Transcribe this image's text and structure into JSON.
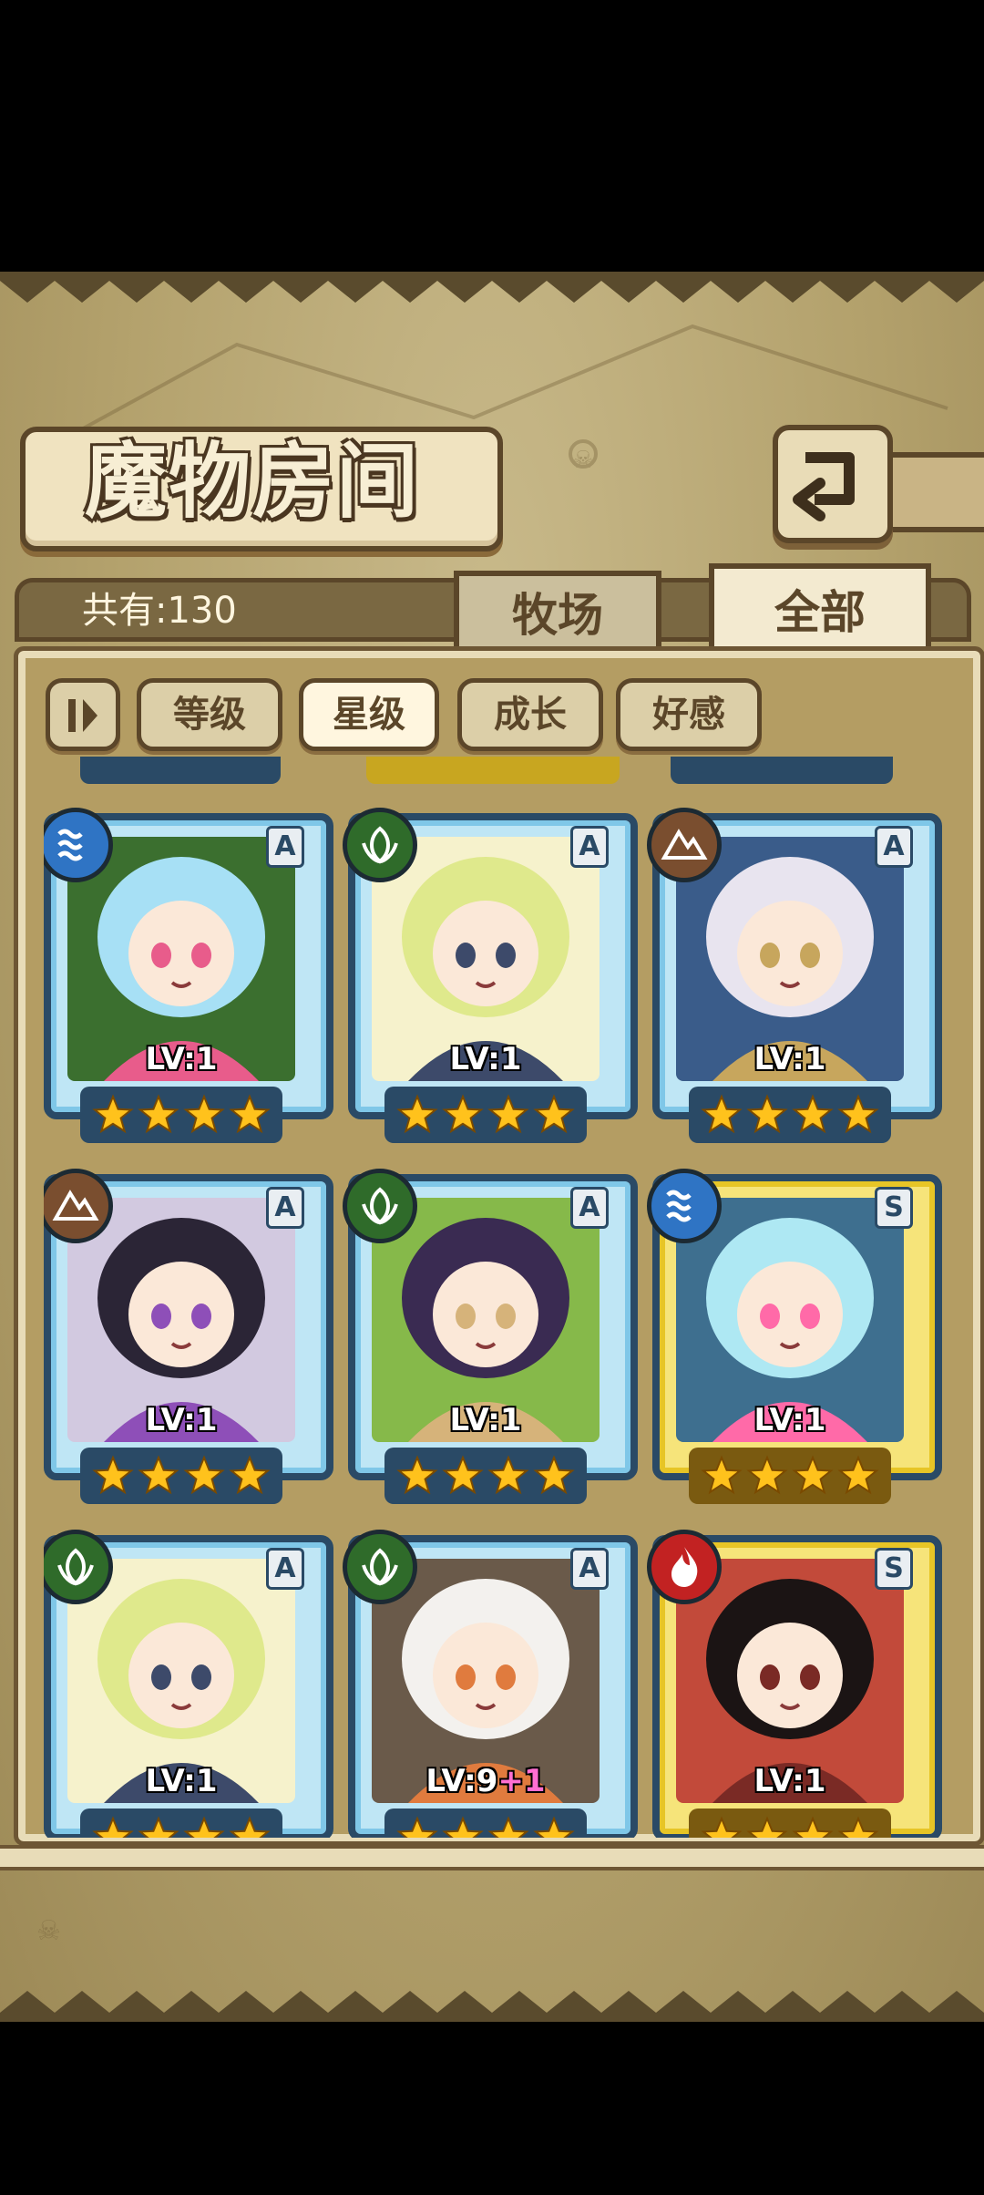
{
  "screen": {
    "title": "魔物房间",
    "count_label": "共有:130",
    "tabs": [
      {
        "label": "牧场",
        "active": false
      },
      {
        "label": "全部",
        "active": true
      }
    ],
    "sort": {
      "toggle_icon": "sort-toggle-icon",
      "options": [
        {
          "label": "等级",
          "selected": false
        },
        {
          "label": "星级",
          "selected": true
        },
        {
          "label": "成长",
          "selected": false
        },
        {
          "label": "好感",
          "selected": false
        }
      ]
    }
  },
  "cards": [
    {
      "element": "water",
      "rank": "A",
      "level": "LV:1",
      "plus": "",
      "stars": 4,
      "palette": [
        "#a7e0f5",
        "#e85c8b",
        "#3b6f2f"
      ]
    },
    {
      "element": "nature",
      "rank": "A",
      "level": "LV:1",
      "plus": "",
      "stars": 4,
      "palette": [
        "#dfe98c",
        "#3d4a6a",
        "#f6f2cc"
      ]
    },
    {
      "element": "earth",
      "rank": "A",
      "level": "LV:1",
      "plus": "",
      "stars": 4,
      "palette": [
        "#e8e4ef",
        "#c7a65d",
        "#3a5c8a"
      ]
    },
    {
      "element": "earth",
      "rank": "A",
      "level": "LV:1",
      "plus": "",
      "stars": 4,
      "palette": [
        "#2b2536",
        "#8e4fb8",
        "#d2c9e0"
      ]
    },
    {
      "element": "nature",
      "rank": "A",
      "level": "LV:1",
      "plus": "",
      "stars": 4,
      "palette": [
        "#3a2b52",
        "#d6b37a",
        "#86b94a"
      ]
    },
    {
      "element": "water",
      "rank": "S",
      "level": "LV:1",
      "plus": "",
      "stars": 4,
      "palette": [
        "#aee8f3",
        "#ff6aa8",
        "#3e6f8f"
      ]
    },
    {
      "element": "nature",
      "rank": "A",
      "level": "LV:1",
      "plus": "",
      "stars": 4,
      "palette": [
        "#dfe98c",
        "#3d4a6a",
        "#f6f2cc"
      ]
    },
    {
      "element": "nature",
      "rank": "A",
      "level": "LV:9",
      "plus": "+1",
      "stars": 4,
      "palette": [
        "#f3f1ee",
        "#e07b3e",
        "#6a5a4a"
      ]
    },
    {
      "element": "fire",
      "rank": "S",
      "level": "LV:1",
      "plus": "",
      "stars": 4,
      "palette": [
        "#1b1414",
        "#7a2a25",
        "#c24a3a"
      ]
    }
  ],
  "colors": {
    "element_water": "#2f74c4",
    "element_nature": "#2f6b2a",
    "element_earth": "#7a4e2f",
    "element_fire": "#c22222",
    "star": "#ffc21c"
  }
}
